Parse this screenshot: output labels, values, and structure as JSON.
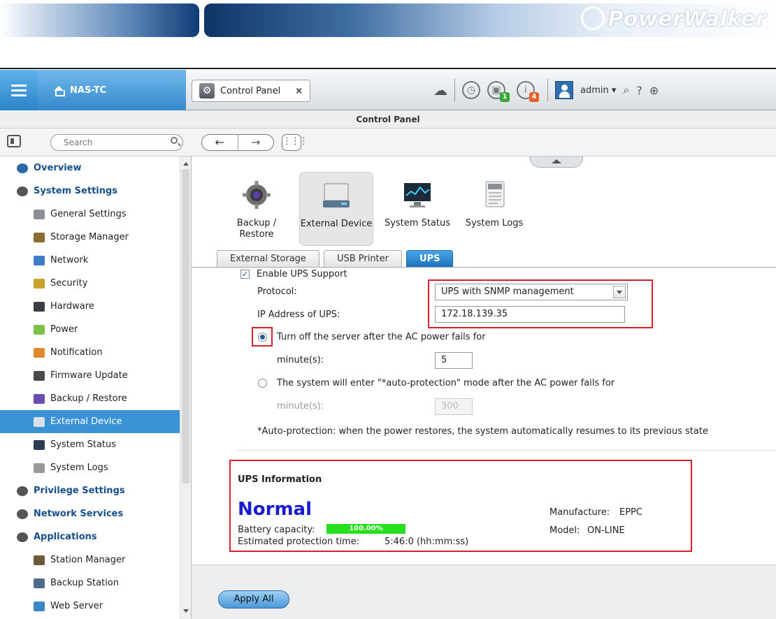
{
  "brand": {
    "name": "PowerWalker"
  },
  "topbar": {
    "nas_name": "NAS-TC",
    "tab_label": "Control Panel",
    "tab_close": "×",
    "badges": {
      "devices": "1",
      "info": "4"
    },
    "user": "admin ▾",
    "colors": {
      "accent": "#3b93d6",
      "badge_green": "#39a835",
      "badge_orange": "#e8602a"
    }
  },
  "window": {
    "title": "Control Panel"
  },
  "toolbar": {
    "search_placeholder": "Search",
    "back": "←",
    "forward": "→",
    "grid": "⋮⋮⋮"
  },
  "sidebar": {
    "items": [
      {
        "label": "Overview",
        "kind": "category",
        "icon": "overview-icon"
      },
      {
        "label": "System Settings",
        "kind": "category",
        "icon": "gear-icon"
      },
      {
        "label": "General Settings",
        "kind": "sub",
        "icon": "general-settings-icon"
      },
      {
        "label": "Storage Manager",
        "kind": "sub",
        "icon": "storage-icon"
      },
      {
        "label": "Network",
        "kind": "sub",
        "icon": "network-icon"
      },
      {
        "label": "Security",
        "kind": "sub",
        "icon": "lock-icon"
      },
      {
        "label": "Hardware",
        "kind": "sub",
        "icon": "hardware-icon"
      },
      {
        "label": "Power",
        "kind": "sub",
        "icon": "bulb-icon"
      },
      {
        "label": "Notification",
        "kind": "sub",
        "icon": "notification-icon"
      },
      {
        "label": "Firmware Update",
        "kind": "sub",
        "icon": "firmware-icon"
      },
      {
        "label": "Backup / Restore",
        "kind": "sub",
        "icon": "backup-icon"
      },
      {
        "label": "External Device",
        "kind": "sub",
        "icon": "external-device-icon",
        "active": true
      },
      {
        "label": "System Status",
        "kind": "sub",
        "icon": "monitor-icon"
      },
      {
        "label": "System Logs",
        "kind": "sub",
        "icon": "log-icon"
      },
      {
        "label": "Privilege Settings",
        "kind": "category",
        "icon": "user-icon"
      },
      {
        "label": "Network Services",
        "kind": "category",
        "icon": "globe-icon"
      },
      {
        "label": "Applications",
        "kind": "category",
        "icon": "applications-icon"
      },
      {
        "label": "Station Manager",
        "kind": "sub",
        "icon": "station-icon"
      },
      {
        "label": "Backup Station",
        "kind": "sub",
        "icon": "backup-station-icon"
      },
      {
        "label": "Web Server",
        "kind": "sub",
        "icon": "web-server-icon"
      }
    ]
  },
  "apps": [
    {
      "label": "Backup / Restore",
      "icon": "backup-restore-app-icon"
    },
    {
      "label": "External Device",
      "icon": "external-device-app-icon",
      "selected": true
    },
    {
      "label": "System Status",
      "icon": "system-status-app-icon"
    },
    {
      "label": "System Logs",
      "icon": "system-logs-app-icon"
    }
  ],
  "tabs": [
    {
      "label": "External Storage"
    },
    {
      "label": "USB Printer"
    },
    {
      "label": "UPS",
      "active": true
    }
  ],
  "ups_form": {
    "enable_label": "Enable UPS Support",
    "enable_checked": true,
    "protocol_label": "Protocol:",
    "protocol_value": "UPS with SNMP management",
    "ip_label": "IP Address of UPS:",
    "ip_value": "172.18.139.35",
    "option1_label": "Turn off the server after the AC power fails for",
    "option1_minutes_label": "minute(s):",
    "option1_minutes": "5",
    "option2_label": "The system will enter \"*auto-protection\" mode after the AC power fails for",
    "option2_minutes_label": "minute(s):",
    "option2_minutes": "300",
    "footnote": "*Auto-protection: when the power restores, the system automatically resumes to its previous state"
  },
  "ups_info": {
    "title": "UPS Information",
    "status": "Normal",
    "battery_label": "Battery capacity:",
    "battery_value": "100.00%",
    "battery_fraction": 1.0,
    "protection_label": "Estimated protection time:",
    "protection_value": "5:46:0 (hh:mm:ss)",
    "manufacture_label": "Manufacture:",
    "manufacture_value": "EPPC",
    "model_label": "Model:",
    "model_value": "ON-LINE"
  },
  "footer": {
    "apply_label": "Apply All"
  }
}
